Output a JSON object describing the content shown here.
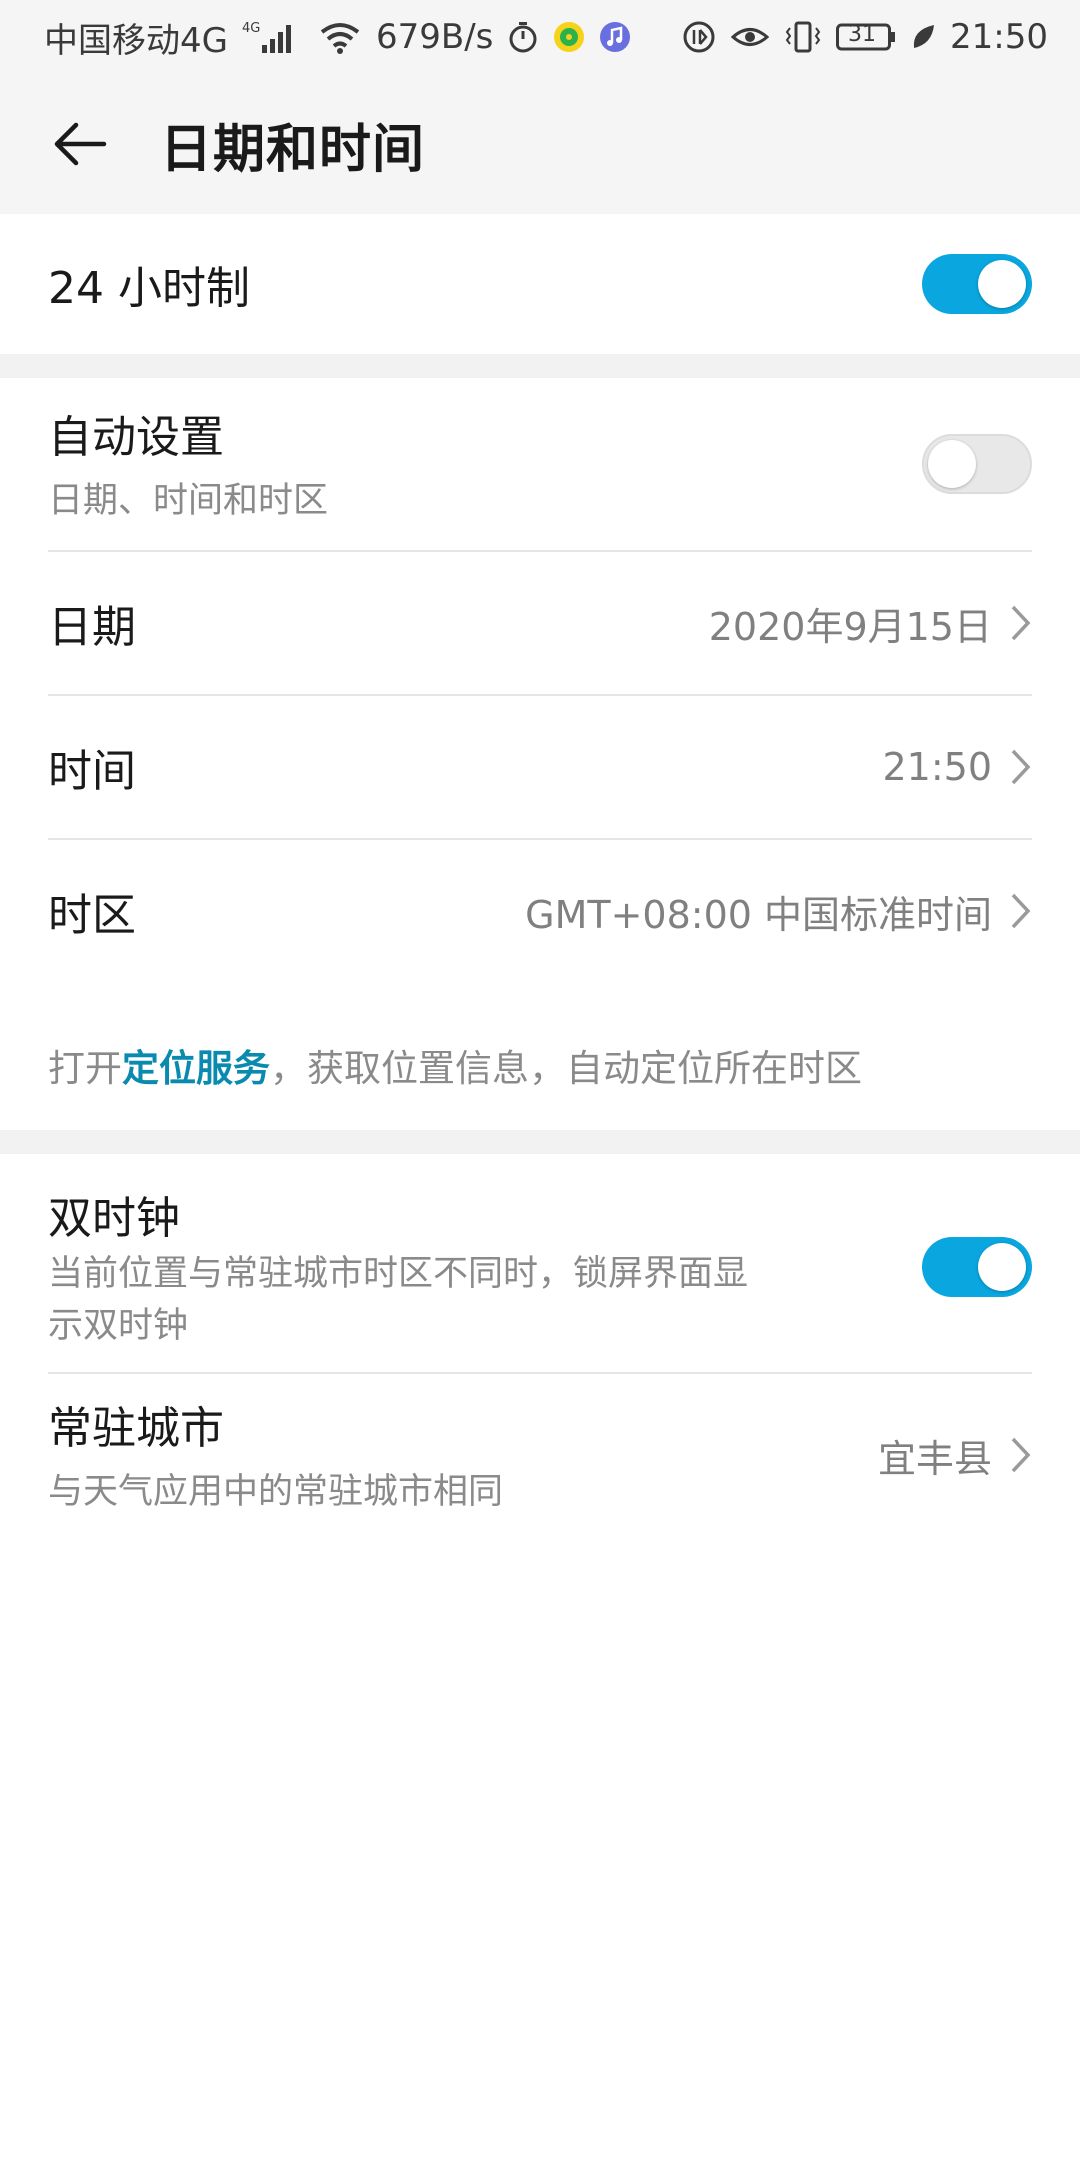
{
  "status_bar": {
    "carrier": "中国移动4G",
    "network_badge": "4G",
    "speed": "679B/s",
    "battery": "31",
    "time": "21:50",
    "icons": [
      "signal-icon",
      "wifi-icon",
      "stopwatch-icon",
      "music-app-icon",
      "music-note-icon",
      "data-saver-icon",
      "eye-comfort-icon",
      "vibrate-icon",
      "battery-icon",
      "leaf-icon"
    ]
  },
  "header": {
    "title": "日期和时间"
  },
  "items": {
    "hour24": {
      "label": "24 小时制",
      "toggle": true
    },
    "auto": {
      "label": "自动设置",
      "sub": "日期、时间和时区",
      "toggle": false
    },
    "date": {
      "label": "日期",
      "value": "2020年9月15日"
    },
    "time": {
      "label": "时间",
      "value": "21:50"
    },
    "timezone": {
      "label": "时区",
      "value": "GMT+08:00 中国标准时间"
    },
    "dual_clock": {
      "label": "双时钟",
      "sub1": "当前位置与常驻城市时区不同时，锁屏界面显",
      "sub2": "示双时钟",
      "toggle": true
    },
    "home_city": {
      "label": "常驻城市",
      "sub": "与天气应用中的常驻城市相同",
      "value": "宜丰县"
    }
  },
  "hint": {
    "prefix": "打开",
    "link": "定位服务",
    "suffix": "，获取位置信息，自动定位所在时区"
  },
  "colors": {
    "accent": "#0aa6df",
    "link": "#0a8aae",
    "background": "#f5f5f5"
  }
}
